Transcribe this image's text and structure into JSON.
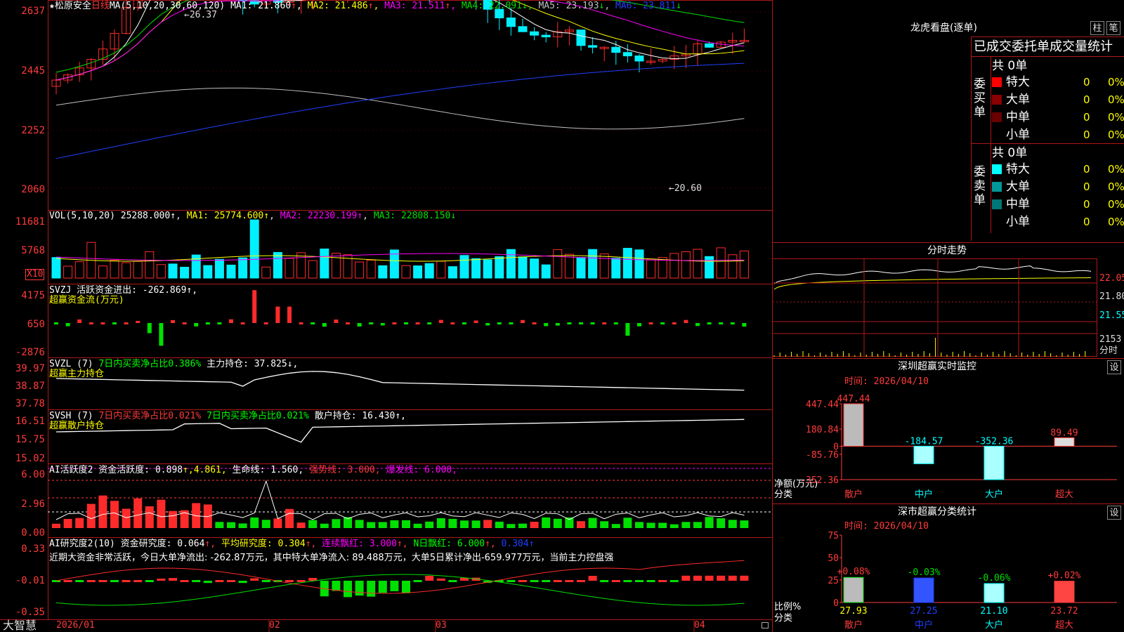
{
  "colors": {
    "up": "#ff2b2b",
    "down": "#00f0ff",
    "ma1": "#ffffff",
    "ma2": "#ffff00",
    "ma3": "#ff00ff",
    "ma4": "#00e000",
    "ma5": "#c0c0c0",
    "ma6": "#2040ff",
    "grid": "#8b1010"
  },
  "main": {
    "axis": [
      "2637",
      "2445",
      "2252",
      "2060"
    ],
    "star": "★",
    "name": "松原安全",
    "period": "日线",
    "ma_params": "MA(5,10,20,30,60,120)",
    "ma": [
      {
        "label": "MA1:",
        "value": "21.860",
        "arrow": "↑"
      },
      {
        "label": "MA2:",
        "value": "21.486",
        "arrow": "↑"
      },
      {
        "label": "MA3:",
        "value": "21.511",
        "arrow": "↑"
      },
      {
        "label": "MA4:",
        "value": "22.091",
        "arrow": "↓"
      },
      {
        "label": "MA5:",
        "value": "23.193",
        "arrow": "↓"
      },
      {
        "label": "MA6:",
        "value": "23.811",
        "arrow": "↓"
      }
    ],
    "high_mark": "←26.37",
    "low_mark": "←20.60"
  },
  "vol": {
    "axis": [
      "11681",
      "5768"
    ],
    "unit": "X10",
    "params": "VOL(5,10,20)",
    "value": "25288.000↑",
    "ma1": "MA1: 25774.600↑",
    "ma2": "MA2: 22230.199↑",
    "ma3": "MA3: 22808.150↓"
  },
  "svzj": {
    "axis": [
      "4175",
      "650",
      "-2876"
    ],
    "line1": "SVZJ  活跃资金进出: -262.869↑,",
    "line2": "超赢资金流(万元)"
  },
  "svzl": {
    "axis": [
      "39.97",
      "38.87",
      "37.78"
    ],
    "line1a": "SVZL (7) ",
    "line1b": "7日内买卖净占比0.386%",
    "line1c": " 主力持仓: 37.825↓,",
    "line2": "超赢主力持仓"
  },
  "svsh": {
    "axis": [
      "16.51",
      "15.75",
      "15.02"
    ],
    "line1a": "SVSH (7) ",
    "line1b": "7日内买卖净占比0.021%",
    "line1c": " 7日内买卖净占比0.021%",
    "line1d": " 散户持仓: 16.430↑,",
    "line2": "超赢散户持仓"
  },
  "ai1": {
    "axis": [
      "6.00",
      "2.96",
      "0.00"
    ],
    "t1": "AI活跃度2 资金活跃度: 0.898",
    "t2": "↑,4.861,",
    "t3": " 生命线: 1.560,",
    "t4": " 强势线: 3.000,",
    "t5": " 爆发线: 6.000,"
  },
  "ai2": {
    "axis": [
      "0.33",
      "-0.01",
      "-0.35"
    ],
    "t1": "AI研究度2(10) 资金研究度: 0.064",
    "t2": "↑,",
    "t3": " 平均研究度: 0.304",
    "t4": "↑,",
    "t5": " 连续飘红: 3.000",
    "t6": "↑,",
    "t7": " N日飘红: 6.000",
    "t8": "↑,",
    "t9": " 0.304↑",
    "note": "近期大资金非常活跃，今日大单净流出: -262.87万元，其中特大单净流入: 89.488万元，大单5日累计净出-659.977万元，当前主力控盘强"
  },
  "xaxis": {
    "brand": "大智慧",
    "labels": [
      "2026/01",
      "02",
      "03",
      "04"
    ]
  },
  "right": {
    "dragon": {
      "title": "龙虎看盘(逐单)",
      "btn1": "柱",
      "btn2": "笔",
      "subtitle": "已成交委托单成交量统计"
    },
    "buy": {
      "side": "委买单",
      "total": "共 0单",
      "rows": [
        {
          "name": "特大",
          "count": "0",
          "pct": "0%",
          "color": "#ff0000"
        },
        {
          "name": "大单",
          "count": "0",
          "pct": "0%",
          "color": "#8b0000"
        },
        {
          "name": "中单",
          "count": "0",
          "pct": "0%",
          "color": "#6a0000"
        },
        {
          "name": "小单",
          "count": "0",
          "pct": "0%",
          "color": "#000000"
        }
      ]
    },
    "sell": {
      "side": "委卖单",
      "total": "共 0单",
      "rows": [
        {
          "name": "特大",
          "count": "0",
          "pct": "0%",
          "color": "#00ffff"
        },
        {
          "name": "大单",
          "count": "0",
          "pct": "0%",
          "color": "#009999"
        },
        {
          "name": "中单",
          "count": "0",
          "pct": "0%",
          "color": "#007777"
        },
        {
          "name": "小单",
          "count": "0",
          "pct": "0%",
          "color": "#000000"
        }
      ]
    },
    "intraday": {
      "title": "分时走势",
      "axis": [
        "22.05",
        "21.80",
        "21.55",
        "2153"
      ],
      "foot": "分时"
    },
    "sz_monitor": {
      "title": "深圳超赢实时监控",
      "btn": "设",
      "time": "时间: 2026/04/10",
      "axis": [
        "447.44",
        "180.84",
        "0",
        "-85.76",
        "-352.36"
      ],
      "ylabel1": "净额(万元)",
      "ylabel2": "分类",
      "bars": [
        {
          "cat": "散户",
          "value": 447.44,
          "label": "447.44"
        },
        {
          "cat": "中户",
          "value": -184.57,
          "label": "-184.57"
        },
        {
          "cat": "大户",
          "value": -352.36,
          "label": "-352.36"
        },
        {
          "cat": "超大",
          "value": 89.49,
          "label": "89.49"
        }
      ]
    },
    "sz_class": {
      "title": "深市超赢分类统计",
      "btn": "设",
      "time": "时间: 2026/04/10",
      "axis": [
        "75",
        "50",
        "25",
        "0"
      ],
      "ylabel1": "比例%",
      "ylabel2": "分类",
      "bars": [
        {
          "cat": "散户",
          "value": 27.93,
          "label": "27.93",
          "chg": "+0.08%"
        },
        {
          "cat": "中户",
          "value": 27.25,
          "label": "27.25",
          "chg": "-0.03%"
        },
        {
          "cat": "大户",
          "value": 21.1,
          "label": "21.10",
          "chg": "-0.06%"
        },
        {
          "cat": "超大",
          "value": 23.72,
          "label": "23.72",
          "chg": "+0.02%"
        }
      ]
    }
  },
  "chart_data": [
    {
      "type": "bar",
      "title": "深圳超赢实时监控",
      "ylabel": "净额(万元)",
      "categories": [
        "散户",
        "中户",
        "大户",
        "超大"
      ],
      "values": [
        447.44,
        -184.57,
        -352.36,
        89.49
      ],
      "ylim": [
        -352.36,
        447.44
      ]
    },
    {
      "type": "bar",
      "title": "深市超赢分类统计",
      "ylabel": "比例%",
      "categories": [
        "散户",
        "中户",
        "大户",
        "超大"
      ],
      "values": [
        27.93,
        27.25,
        21.1,
        23.72
      ],
      "ylim": [
        0,
        75
      ]
    }
  ]
}
